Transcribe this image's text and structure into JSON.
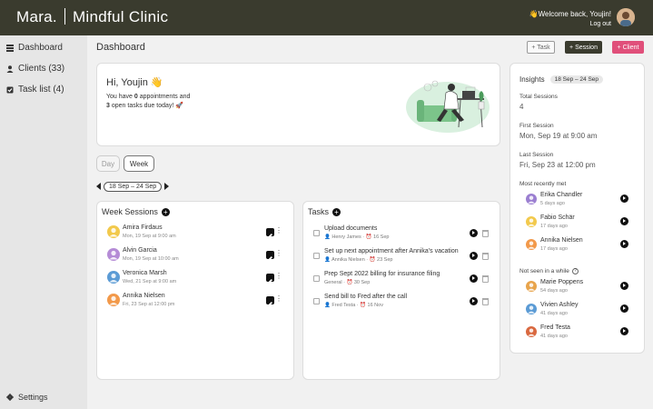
{
  "header": {
    "brand_name": "Mara.",
    "brand_suffix": "Mindful Clinic",
    "welcome": "👋Welcome back, Youjin!",
    "logout": "Log out"
  },
  "sidebar": {
    "items": [
      {
        "label": "Dashboard",
        "icon": "menu-icon"
      },
      {
        "label": "Clients (33)",
        "icon": "user-icon"
      },
      {
        "label": "Task list (4)",
        "icon": "checkbox-icon"
      }
    ],
    "settings": "Settings"
  },
  "page": {
    "title": "Dashboard",
    "buttons": {
      "task": "+ Task",
      "session": "+ Session",
      "client": "+ Client"
    }
  },
  "hero": {
    "greeting": "Hi, Youjin 👋",
    "line1_prefix": "You have ",
    "appointments": "0",
    "line1_suffix": " appointments and",
    "open_tasks": "3",
    "line2_suffix": " open tasks due today! 🚀"
  },
  "view": {
    "day": "Day",
    "week": "Week",
    "range": "18 Sep – 24 Sep"
  },
  "sessions": {
    "title": "Week Sessions",
    "items": [
      {
        "name": "Amira Firdaus",
        "when": "Mon, 19 Sep at 9:00 am",
        "color": "#f2c94c"
      },
      {
        "name": "Alvin Garcia",
        "when": "Mon, 19 Sep at 10:00 am",
        "color": "#b58cd6"
      },
      {
        "name": "Veronica Marsh",
        "when": "Wed, 21 Sep at 9:00 am",
        "color": "#5b9bd5"
      },
      {
        "name": "Annika Nielsen",
        "when": "Fri, 23 Sep at 12:00 pm",
        "color": "#f2994a"
      }
    ]
  },
  "tasks": {
    "title": "Tasks",
    "items": [
      {
        "name": "Upload documents",
        "meta": "👤 Henry James · ⏰ 16 Sep"
      },
      {
        "name": "Set up next appointment after Annika's vacation",
        "meta": "👤 Annika Nielsen · ⏰ 23 Sep"
      },
      {
        "name": "Prep Sept 2022 billing for insurance filing",
        "meta": "General · ⏰ 30 Sep"
      },
      {
        "name": "Send bill to Fred after the call",
        "meta": "👤 Fred Testa · ⏰ 16 Nov"
      }
    ]
  },
  "insights": {
    "title": "Insights",
    "range": "18 Sep – 24 Sep",
    "total_sessions_label": "Total Sessions",
    "total_sessions_value": "4",
    "first_session_label": "First Session",
    "first_session_value": "Mon, Sep 19 at 9:00 am",
    "last_session_label": "Last Session",
    "last_session_value": "Fri, Sep 23 at 12:00 pm",
    "recent_label": "Most recently met",
    "recent": [
      {
        "name": "Erika Chandler",
        "ago": "5 days ago",
        "color": "#9b7fd1"
      },
      {
        "name": "Fabio Schär",
        "ago": "17 days ago",
        "color": "#f2c94c"
      },
      {
        "name": "Annika Nielsen",
        "ago": "17 days ago",
        "color": "#f2994a"
      }
    ],
    "unseen_label": "Not seen in a while",
    "unseen": [
      {
        "name": "Marie Poppens",
        "ago": "54 days ago",
        "color": "#e8a44c"
      },
      {
        "name": "Vivien Ashley",
        "ago": "41 days ago",
        "color": "#5b9bd5"
      },
      {
        "name": "Fred Testa",
        "ago": "41 days ago",
        "color": "#d9683f"
      }
    ]
  }
}
